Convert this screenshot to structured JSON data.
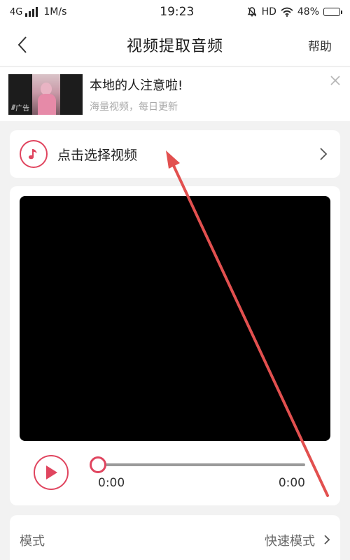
{
  "status_bar": {
    "network": "4G",
    "speed": "1M/s",
    "time": "19:23",
    "hd": "HD",
    "battery_text": "48%",
    "battery_level": 0.48
  },
  "header": {
    "back_icon": "chevron-left-icon",
    "title": "视频提取音频",
    "help_label": "帮助"
  },
  "ad": {
    "title": "本地的人注意啦!",
    "subtitle": "海量视频，每日更新",
    "tag": "广告",
    "close_icon": "close-icon"
  },
  "select_video": {
    "icon": "music-note-icon",
    "label": "点击选择视频",
    "chevron_icon": "chevron-right-icon"
  },
  "player": {
    "play_icon": "play-icon",
    "progress": 0,
    "current_time": "0:00",
    "total_time": "0:00"
  },
  "mode": {
    "label": "模式",
    "value": "快速模式",
    "chevron_icon": "chevron-right-icon"
  },
  "colors": {
    "accent": "#e0455f",
    "annotation_arrow": "#e2504f",
    "background": "#f2f2f2",
    "card": "#ffffff",
    "video_area": "#000000"
  }
}
